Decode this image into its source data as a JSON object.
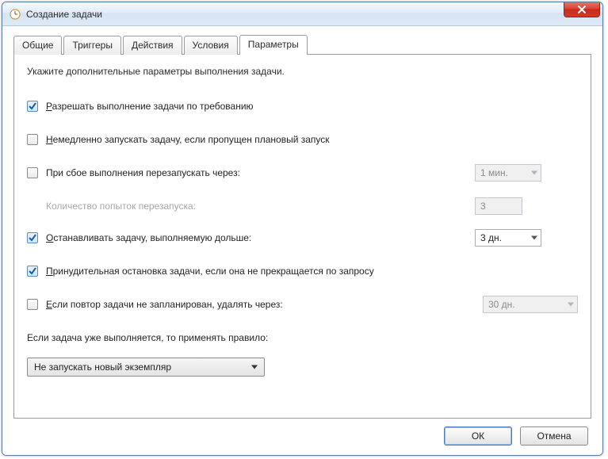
{
  "window": {
    "title": "Создание задачи"
  },
  "tabs": {
    "t0": "Общие",
    "t1": "Триггеры",
    "t2": "Действия",
    "t3": "Условия",
    "t4": "Параметры"
  },
  "description": "Укажите дополнительные параметры выполнения задачи.",
  "options": {
    "allow_on_demand": {
      "label_pre": "Р",
      "label_post": "азрешать выполнение задачи по требованию",
      "checked": true
    },
    "run_if_missed": {
      "label_pre": "Н",
      "label_post": "емедленно запускать задачу, если пропущен плановый запуск",
      "checked": false
    },
    "restart_on_fail": {
      "label": "При сбое выполнения перезапускать через:",
      "checked": false,
      "value": "1 мин."
    },
    "restart_count": {
      "label": "Количество попыток перезапуска:",
      "value": "3"
    },
    "stop_if_longer": {
      "label_pre": "О",
      "label_post": "станавливать задачу, выполняемую дольше:",
      "checked": true,
      "value": "3 дн."
    },
    "force_stop": {
      "label_pre": "П",
      "label_post": "ринудительная остановка задачи, если она не прекращается по запросу",
      "checked": true
    },
    "delete_after": {
      "label_pre": "Е",
      "label_post": "сли повтор задачи не запланирован, удалять через:",
      "checked": false,
      "value": "30 дн."
    },
    "rule_label": "Если задача уже выполняется, то применять правило:",
    "rule_value": "Не запускать новый экземпляр"
  },
  "buttons": {
    "ok": "ОК",
    "cancel": "Отмена"
  }
}
